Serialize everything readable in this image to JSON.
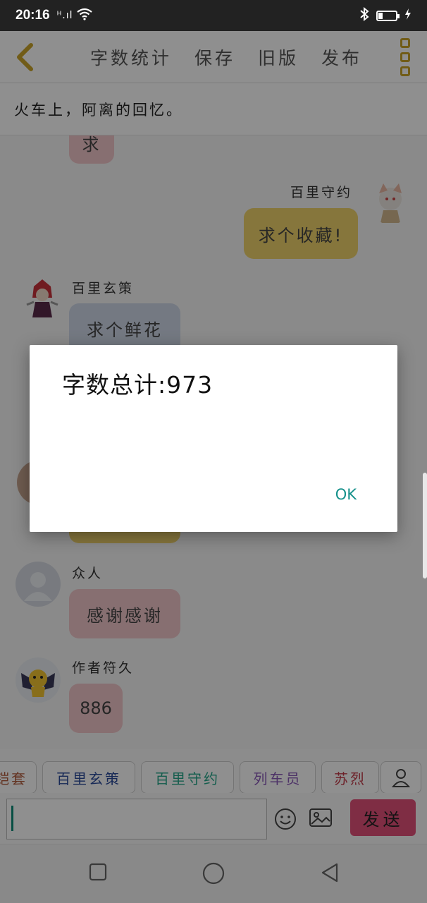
{
  "status_bar": {
    "time": "20:16",
    "signal": "ᴴ.ıl"
  },
  "toolbar": {
    "items": [
      "字数统计",
      "保存",
      "旧版",
      "发布"
    ]
  },
  "chapter_title": "火车上，阿离的回忆。",
  "chat": {
    "partial_bubble": "求",
    "messages": [
      {
        "name": "百里守约",
        "text": "求个收藏!"
      },
      {
        "name": "百里玄策",
        "text": "求个鲜花"
      },
      {
        "name": "众人",
        "text": "感谢感谢"
      },
      {
        "name": "作者符久",
        "text": "886"
      }
    ]
  },
  "quick_chips": [
    "铠套",
    "百里玄策",
    "百里守约",
    "列车员",
    "苏烈"
  ],
  "input": {
    "value": ""
  },
  "send_label": "发送",
  "dialog": {
    "message": "字数总计:973",
    "ok_label": "OK"
  },
  "colors": {
    "accent": "#caa42a",
    "send": "#e2507a",
    "ok": "#16918b"
  }
}
